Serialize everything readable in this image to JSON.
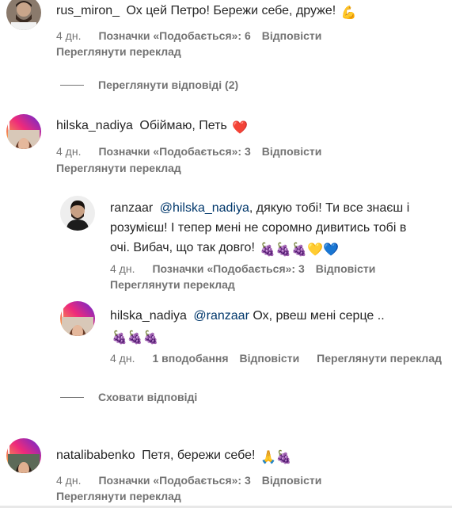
{
  "comments": [
    {
      "username": "rus_miron_",
      "text": "Ох цей Петро! Бережи себе, друже!",
      "emoji": "💪",
      "time": "4 дн.",
      "likes": "Позначки «Подобається»: 6",
      "reply": "Відповісти",
      "translate": "Переглянути переклад",
      "avatar_icon": "bearded-man-avatar"
    },
    {
      "username": "hilska_nadiya",
      "text": "Обіймаю, Петь",
      "emoji": "❤️",
      "time": "4 дн.",
      "likes": "Позначки «Подобається»: 3",
      "reply": "Відповісти",
      "translate": "Переглянути переклад",
      "avatar_icon": "woman-avatar"
    },
    {
      "username": "natalibabenko",
      "text": "Петя, бережи себе!",
      "emoji": "🙏🍇",
      "time": "4 дн.",
      "likes": "Позначки «Подобається»: 3",
      "reply": "Відповісти",
      "translate": "Переглянути переклад",
      "avatar_icon": "woman-dark-hair-avatar"
    }
  ],
  "view_replies": "Переглянути відповіді (2)",
  "hide_replies": "Сховати відповіді",
  "replies": [
    {
      "username": "ranzaar",
      "mention": "@hilska_nadiya",
      "text_line1": ", дякую тобі! Ти все знаєш і",
      "text_line2": "розумієш! І тепер мені не соромно дивитись тобі в",
      "text_line3": "очі. Вибач, що так довго!",
      "emoji": "🍇🍇🍇💛💙",
      "time": "4 дн.",
      "likes": "Позначки «Подобається»: 3",
      "reply": "Відповісти",
      "translate": "Переглянути переклад",
      "avatar_icon": "man-dark-hair-avatar"
    },
    {
      "username": "hilska_nadiya",
      "mention": "@ranzaar",
      "text": "Ох, рвеш мені серце ..",
      "emoji": "🍇🍇🍇",
      "time": "4 дн.",
      "likes": "1 вподобання",
      "reply": "Відповісти",
      "translate": "Переглянути переклад",
      "avatar_icon": "woman-avatar"
    }
  ],
  "colors": {
    "text": "#262626",
    "secondary": "#737373",
    "mention": "#00376b",
    "story_ring_start": "#f9ce34",
    "story_ring_end": "#6228d7"
  }
}
